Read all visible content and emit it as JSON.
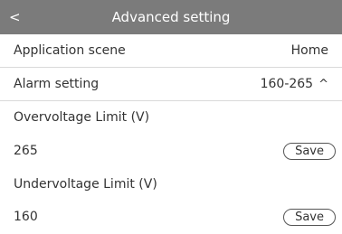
{
  "header": {
    "back_label": "<",
    "title": "Advanced setting"
  },
  "settings": {
    "application_scene": {
      "label": "Application scene",
      "value": "Home"
    },
    "alarm_setting": {
      "label": "Alarm setting",
      "value": "160-265",
      "toggle_icon": "^"
    }
  },
  "overvoltage": {
    "label": "Overvoltage Limit (V)",
    "value": "265",
    "save_label": "Save"
  },
  "undervoltage": {
    "label": "Undervoltage Limit (V)",
    "value": "160",
    "save_label": "Save"
  },
  "colors": {
    "header_background": "#7b7b7b",
    "header_text": "#ffffff",
    "divider": "#d9d9d9",
    "text": "#333333"
  }
}
